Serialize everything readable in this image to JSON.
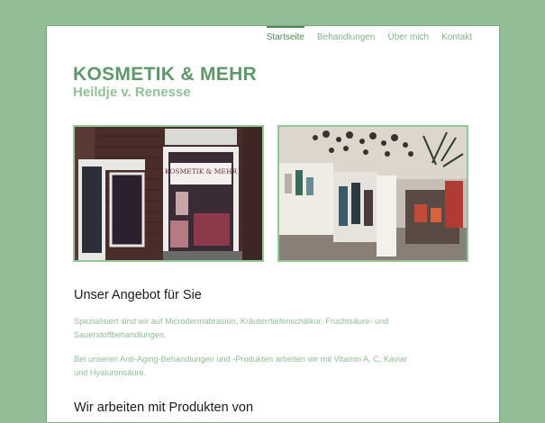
{
  "nav": {
    "items": [
      {
        "label": "Startseite",
        "active": true
      },
      {
        "label": "Behandlungen",
        "active": false
      },
      {
        "label": "Über mich",
        "active": false
      },
      {
        "label": "Kontakt",
        "active": false
      }
    ]
  },
  "logo": {
    "title": "KOSMETIK & MEHR",
    "subtitle": "Heildje v. Renesse"
  },
  "photos": {
    "storefront": {
      "sign": "KOSMETIK & MEHR"
    }
  },
  "content": {
    "heading1": "Unser Angebot für Sie",
    "paragraph1": "Spezialisiert sind wir auf Microdermabrasion, Kräuterrtiefenschälkur, Fruchtsäure- und Sauerstoffbehandlungen.",
    "paragraph2": "Bei unseren Anti-Aging-Behandlungen und -Produkten arbeiten wir mit Vitamin A, C, Kaviar und Hyaluronsäure.",
    "heading2": "Wir arbeiten mit Produkten von"
  },
  "colors": {
    "background": "#93bd97",
    "accent": "#4d8a58",
    "link": "#7fb488",
    "text_green": "#8dbe94"
  }
}
